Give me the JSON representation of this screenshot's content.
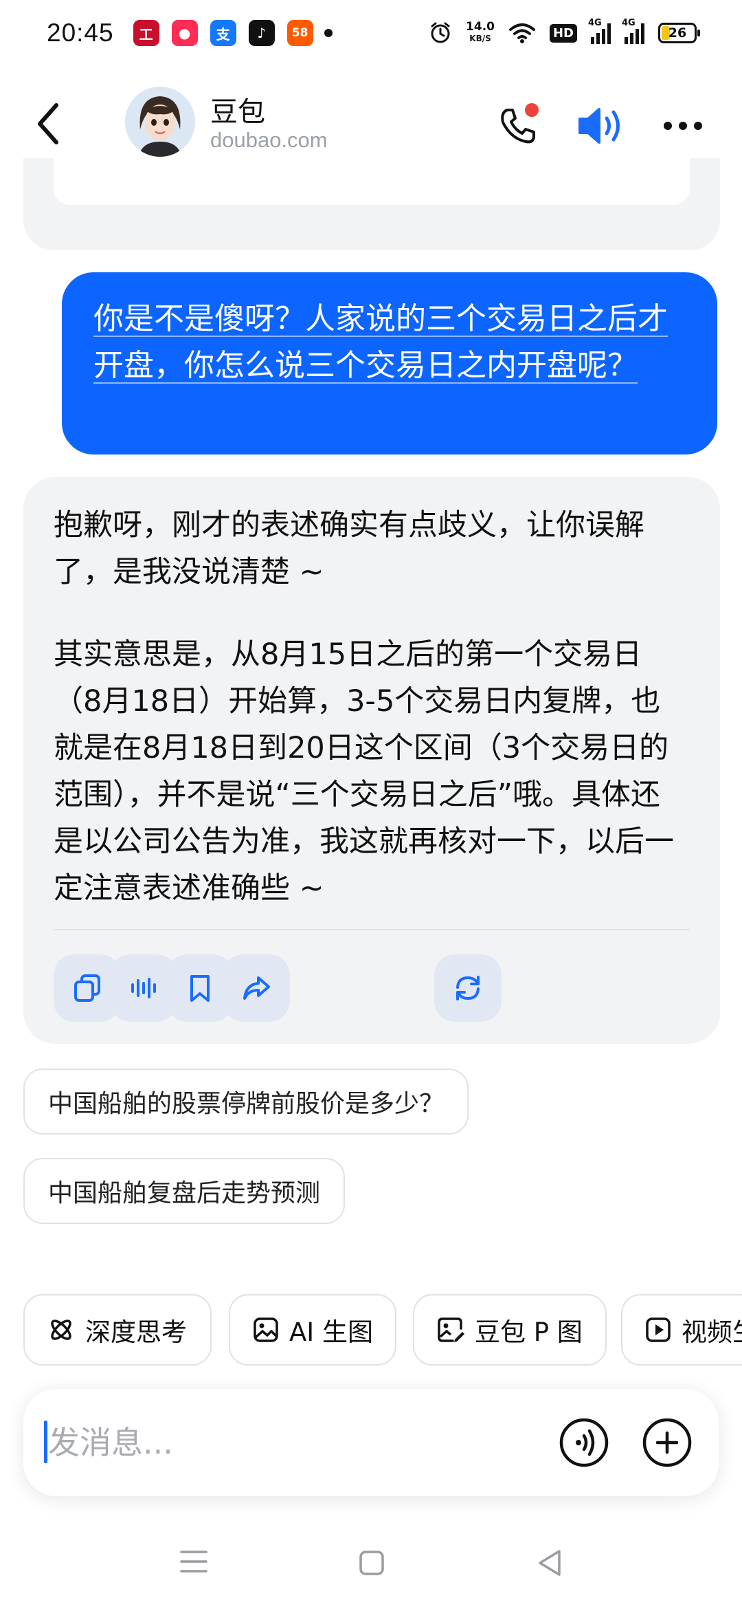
{
  "status_bar": {
    "time": "20:45",
    "net_speed_value": "14.0",
    "net_speed_unit": "KB/S",
    "hd": "HD",
    "net1": "4G",
    "net2": "4G",
    "battery": "26",
    "battery_level": 0.26,
    "app_icons": [
      {
        "name": "bank-app-icon",
        "text": "工",
        "color": "#c8102e"
      },
      {
        "name": "red-circle-app-icon",
        "text": "●",
        "color": "#ff2d55"
      },
      {
        "name": "alipay-app-icon",
        "text": "支",
        "color": "#1677ff"
      },
      {
        "name": "tiktok-app-icon",
        "text": "♪",
        "color": "#111111"
      },
      {
        "name": "58-app-icon",
        "text": "58",
        "color": "#ff5a00"
      }
    ]
  },
  "header": {
    "bot_name": "豆包",
    "bot_domain": "doubao.com",
    "accent": "#1a6cff",
    "notify_color": "#f0413a"
  },
  "chat": {
    "user_message": "你是不是傻呀？人家说的三个交易日之后才开盘，你怎么说三个交易日之内开盘呢？",
    "ai_paragraph_1": "抱歉呀，刚才的表述确实有点歧义，让你误解了，是我没说清楚 ~",
    "ai_paragraph_2": "其实意思是，从8月15日之后的第一个交易日（8月18日）开始算，3-5个交易日内复牌，也就是在8月18日到20日这个区间（3个交易日的范围），并不是说“三个交易日之后”哦。具体还是以公司公告为准，我这就再核对一下，以后一定注意表述准确些 ~",
    "user_bubble_color": "#0d65ff",
    "ai_bubble_color": "#f2f3f5"
  },
  "suggestions": [
    "中国船舶的股票停牌前股价是多少？",
    "中国船舶复盘后走势预测"
  ],
  "tools": [
    {
      "label": "深度思考",
      "icon": "atom-icon"
    },
    {
      "label": "AI 生图",
      "icon": "image-icon"
    },
    {
      "label": "豆包 P 图",
      "icon": "photo-edit-icon"
    },
    {
      "label": "视频生",
      "icon": "video-icon"
    }
  ],
  "input": {
    "placeholder": "发消息..."
  }
}
